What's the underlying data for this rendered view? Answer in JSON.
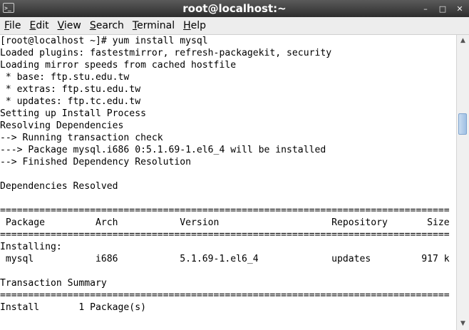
{
  "window": {
    "title": "root@localhost:~",
    "icon": "terminal-icon",
    "controls": [
      "–",
      "□",
      "✕"
    ]
  },
  "menubar": {
    "items": [
      {
        "label": "File",
        "mnemonic": "F",
        "rest": "ile"
      },
      {
        "label": "Edit",
        "mnemonic": "E",
        "rest": "dit"
      },
      {
        "label": "View",
        "mnemonic": "V",
        "rest": "iew"
      },
      {
        "label": "Search",
        "mnemonic": "S",
        "rest": "earch"
      },
      {
        "label": "Terminal",
        "mnemonic": "T",
        "rest": "erminal"
      },
      {
        "label": "Help",
        "mnemonic": "H",
        "rest": "elp"
      }
    ]
  },
  "terminal": {
    "lines": [
      "[root@localhost ~]# yum install mysql",
      "Loaded plugins: fastestmirror, refresh-packagekit, security",
      "Loading mirror speeds from cached hostfile",
      " * base: ftp.stu.edu.tw",
      " * extras: ftp.stu.edu.tw",
      " * updates: ftp.tc.edu.tw",
      "Setting up Install Process",
      "Resolving Dependencies",
      "--> Running transaction check",
      "---> Package mysql.i686 0:5.1.69-1.el6_4 will be installed",
      "--> Finished Dependency Resolution",
      "",
      "Dependencies Resolved",
      "",
      "================================================================================",
      " Package         Arch           Version                    Repository       Size",
      "================================================================================",
      "Installing:",
      " mysql           i686           5.1.69-1.el6_4             updates         917 k",
      "",
      "Transaction Summary",
      "================================================================================",
      "Install       1 Package(s)"
    ]
  },
  "scrollbar": {
    "up_icon": "▲",
    "down_icon": "▼"
  }
}
